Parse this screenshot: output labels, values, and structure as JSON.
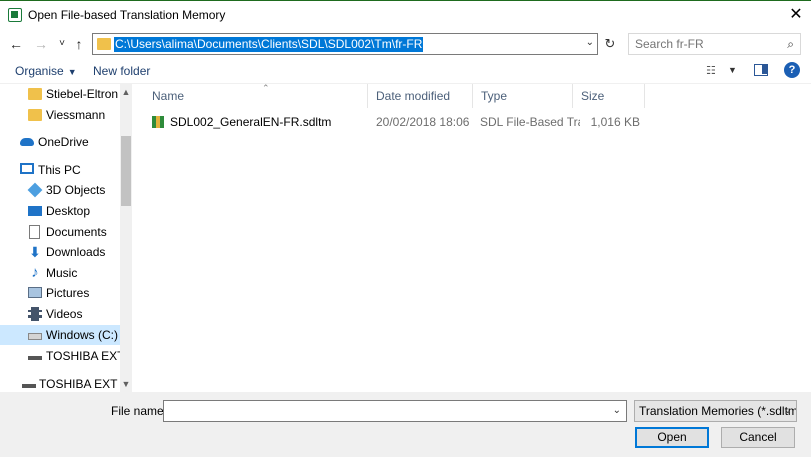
{
  "window": {
    "title": "Open File-based Translation Memory",
    "close_glyph": "✕"
  },
  "nav": {
    "back_glyph": "←",
    "forward_glyph": "→",
    "recent_glyph": "˅",
    "up_glyph": "↑",
    "refresh_glyph": "↻"
  },
  "address": {
    "path": "C:\\Users\\alima\\Documents\\Clients\\SDL\\SDL002\\Tm\\fr-FR",
    "dropdown_glyph": "⌄"
  },
  "search": {
    "placeholder": "Search fr-FR",
    "icon": "search-icon"
  },
  "toolbar": {
    "organise_label": "Organise",
    "new_folder_label": "New folder",
    "help_glyph": "?"
  },
  "sidebar": {
    "items": [
      {
        "label": "Stiebel-Eltron",
        "icon": "folder-icon"
      },
      {
        "label": "Viessmann",
        "icon": "folder-icon"
      },
      {
        "label": "OneDrive",
        "icon": "onedrive-icon"
      },
      {
        "label": "This PC",
        "icon": "this-pc-icon"
      },
      {
        "label": "3D Objects",
        "icon": "3d-objects-icon"
      },
      {
        "label": "Desktop",
        "icon": "desktop-icon"
      },
      {
        "label": "Documents",
        "icon": "documents-icon"
      },
      {
        "label": "Downloads",
        "icon": "downloads-icon"
      },
      {
        "label": "Music",
        "icon": "music-icon"
      },
      {
        "label": "Pictures",
        "icon": "pictures-icon"
      },
      {
        "label": "Videos",
        "icon": "videos-icon"
      },
      {
        "label": "Windows (C:)",
        "icon": "drive-icon",
        "selected": true
      },
      {
        "label": "TOSHIBA EXT (E:",
        "icon": "usb-drive-icon"
      },
      {
        "label": "TOSHIBA EXT (E:)",
        "icon": "usb-drive-icon"
      }
    ]
  },
  "columns": [
    "Name",
    "Date modified",
    "Type",
    "Size"
  ],
  "files": [
    {
      "name": "SDL002_GeneralEN-FR.sdltm",
      "date_modified": "20/02/2018 18:06",
      "type": "SDL File-Based Tra...",
      "size": "1,016 KB"
    }
  ],
  "footer": {
    "file_name_label": "File name:",
    "file_name_value": "",
    "filter_value": "Translation Memories (*.sdltm)",
    "open_label": "Open",
    "cancel_label": "Cancel"
  },
  "colors": {
    "accent": "#0078d7",
    "selection": "#cce8ff",
    "title_border": "#1e6b1e"
  }
}
